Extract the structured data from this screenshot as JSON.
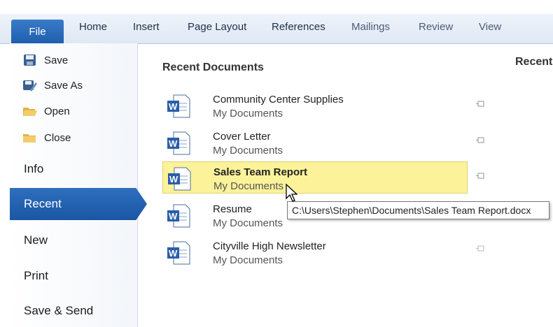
{
  "ribbon": {
    "tabs": [
      "File",
      "Home",
      "Insert",
      "Page Layout",
      "References",
      "Mailings",
      "Review",
      "View"
    ]
  },
  "nav": {
    "commands": [
      {
        "label": "Save",
        "icon": "save-icon"
      },
      {
        "label": "Save As",
        "icon": "save-as-icon"
      },
      {
        "label": "Open",
        "icon": "open-folder-icon"
      },
      {
        "label": "Close",
        "icon": "close-folder-icon"
      }
    ],
    "tabs": [
      "Info",
      "Recent",
      "New",
      "Print",
      "Save & Send"
    ],
    "active_tab": "Recent"
  },
  "recent": {
    "title": "Recent Documents",
    "side_title": "Recent",
    "documents": [
      {
        "name": "Community Center Supplies",
        "location": "My Documents"
      },
      {
        "name": "Cover Letter",
        "location": "My Documents"
      },
      {
        "name": "Sales Team Report",
        "location": "My Documents"
      },
      {
        "name": "Resume",
        "location": "My Documents"
      },
      {
        "name": "Cityville High Newsletter",
        "location": "My Documents"
      }
    ],
    "highlighted_index": 2,
    "tooltip": "C:\\Users\\Stephen\\Documents\\Sales Team Report.docx"
  },
  "colors": {
    "accent": "#1f5fae",
    "highlight": "#fbf29a"
  }
}
